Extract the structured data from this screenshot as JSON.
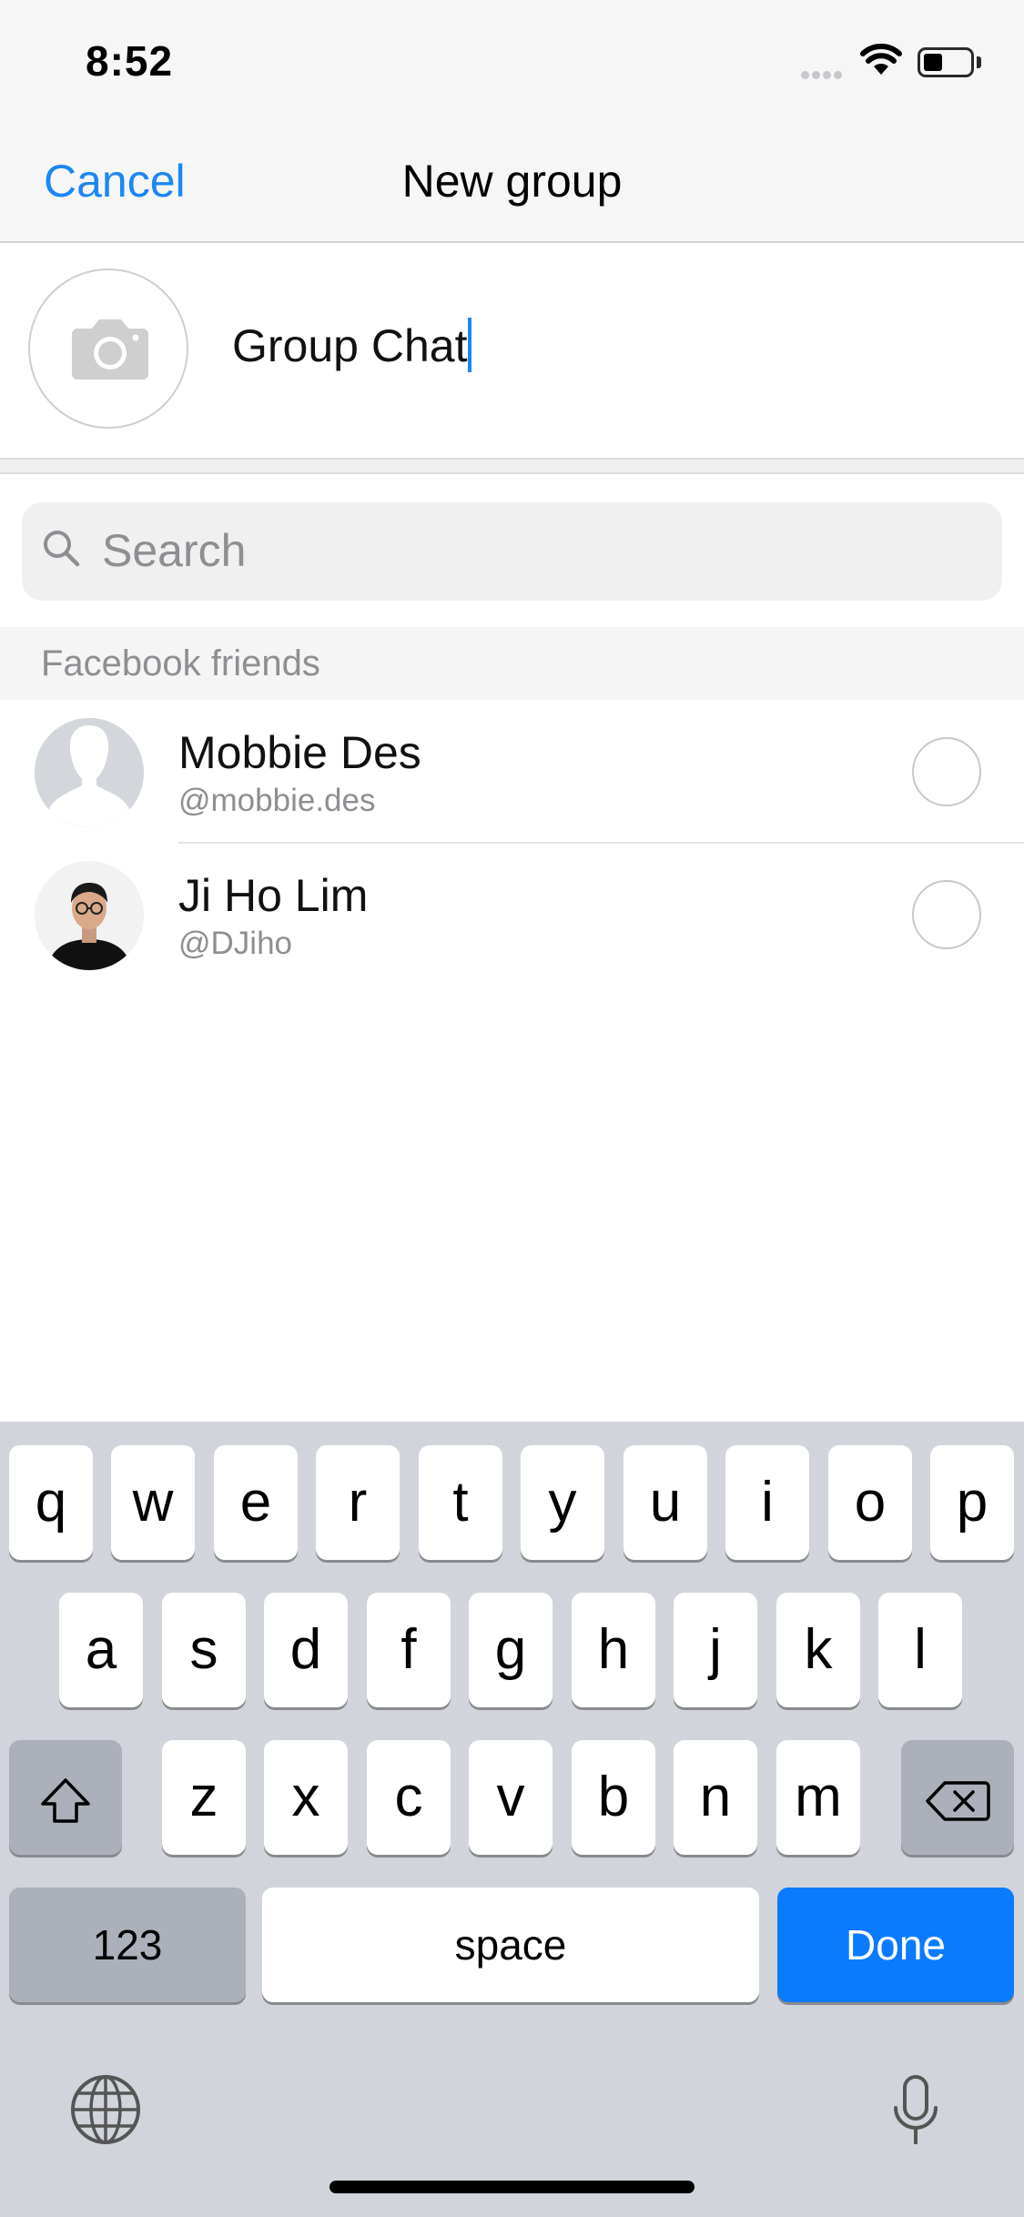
{
  "status_bar": {
    "time": "8:52"
  },
  "nav": {
    "cancel_label": "Cancel",
    "title": "New group"
  },
  "group": {
    "name_value": "Group Chat"
  },
  "search": {
    "placeholder": "Search"
  },
  "section": {
    "label": "Facebook friends"
  },
  "friends": [
    {
      "name": "Mobbie Des",
      "handle": "@mobbie.des",
      "selected": false
    },
    {
      "name": "Ji Ho Lim",
      "handle": "@DJiho",
      "selected": false
    }
  ],
  "keyboard": {
    "row1": [
      "q",
      "w",
      "e",
      "r",
      "t",
      "y",
      "u",
      "i",
      "o",
      "p"
    ],
    "row2": [
      "a",
      "s",
      "d",
      "f",
      "g",
      "h",
      "j",
      "k",
      "l"
    ],
    "row3": [
      "z",
      "x",
      "c",
      "v",
      "b",
      "n",
      "m"
    ],
    "numbers_label": "123",
    "space_label": "space",
    "done_label": "Done"
  },
  "colors": {
    "accent": "#1b87f4",
    "done_key": "#0a7aff",
    "keyboard_bg": "#d1d5db"
  }
}
